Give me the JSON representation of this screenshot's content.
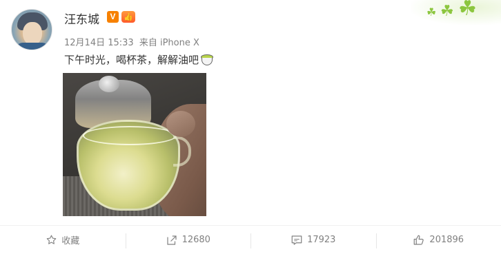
{
  "user": {
    "name": "汪东城",
    "verified_badge": "V",
    "fan_badge": "👍"
  },
  "post": {
    "time": "12月14日 15:33",
    "source_prefix": "来自",
    "source": "iPhone X",
    "text": "下午时光，喝杯茶，解解油吧",
    "emoji_icon": "tea-cup-emoji-icon"
  },
  "actions": {
    "favorite_label": "收藏",
    "repost_count": "12680",
    "comment_count": "17923",
    "like_count": "201896"
  },
  "colors": {
    "verified": "#f78100",
    "text": "#333333",
    "muted": "#808080"
  }
}
